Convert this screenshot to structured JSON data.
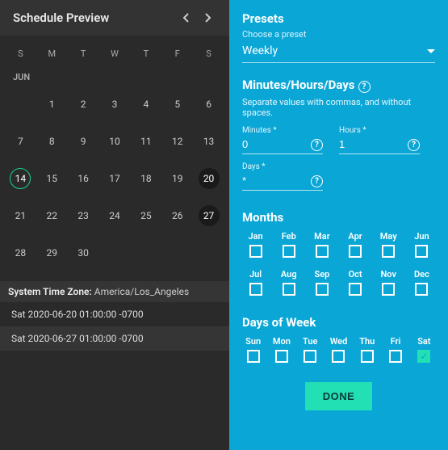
{
  "left": {
    "title": "Schedule Preview",
    "dayHeaders": [
      "S",
      "M",
      "T",
      "W",
      "T",
      "F",
      "S"
    ],
    "monthLabel": "JUN",
    "weeks": [
      [
        "",
        "1",
        "2",
        "3",
        "4",
        "5",
        "6"
      ],
      [
        "7",
        "8",
        "9",
        "10",
        "11",
        "12",
        "13"
      ],
      [
        "14",
        "15",
        "16",
        "17",
        "18",
        "19",
        "20"
      ],
      [
        "21",
        "22",
        "23",
        "24",
        "25",
        "26",
        "27"
      ],
      [
        "28",
        "29",
        "30",
        "",
        "",
        "",
        ""
      ]
    ],
    "selectedDay": "14",
    "highlightDays": [
      "20",
      "27"
    ],
    "tzLabel": "System Time Zone:",
    "tzValue": "America/Los_Angeles",
    "schedule": [
      "Sat 2020-06-20 01:00:00 -0700",
      "Sat 2020-06-27 01:00:00 -0700"
    ]
  },
  "right": {
    "presets": {
      "title": "Presets",
      "sub": "Choose a preset",
      "value": "Weekly"
    },
    "mhd": {
      "title": "Minutes/Hours/Days",
      "hint": "Separate values with commas, and without spaces.",
      "minutesLabel": "Minutes *",
      "minutesValue": "0",
      "hoursLabel": "Hours *",
      "hoursValue": "1",
      "daysLabel": "Days *",
      "daysValue": "*"
    },
    "months": {
      "title": "Months",
      "items": [
        {
          "label": "Jan",
          "checked": false
        },
        {
          "label": "Feb",
          "checked": false
        },
        {
          "label": "Mar",
          "checked": false
        },
        {
          "label": "Apr",
          "checked": false
        },
        {
          "label": "May",
          "checked": false
        },
        {
          "label": "Jun",
          "checked": false
        },
        {
          "label": "Jul",
          "checked": false
        },
        {
          "label": "Aug",
          "checked": false
        },
        {
          "label": "Sep",
          "checked": false
        },
        {
          "label": "Oct",
          "checked": false
        },
        {
          "label": "Nov",
          "checked": false
        },
        {
          "label": "Dec",
          "checked": false
        }
      ]
    },
    "dow": {
      "title": "Days of Week",
      "items": [
        {
          "label": "Sun",
          "checked": false
        },
        {
          "label": "Mon",
          "checked": false
        },
        {
          "label": "Tue",
          "checked": false
        },
        {
          "label": "Wed",
          "checked": false
        },
        {
          "label": "Thu",
          "checked": false
        },
        {
          "label": "Fri",
          "checked": false
        },
        {
          "label": "Sat",
          "checked": true
        }
      ]
    },
    "doneLabel": "DONE"
  }
}
